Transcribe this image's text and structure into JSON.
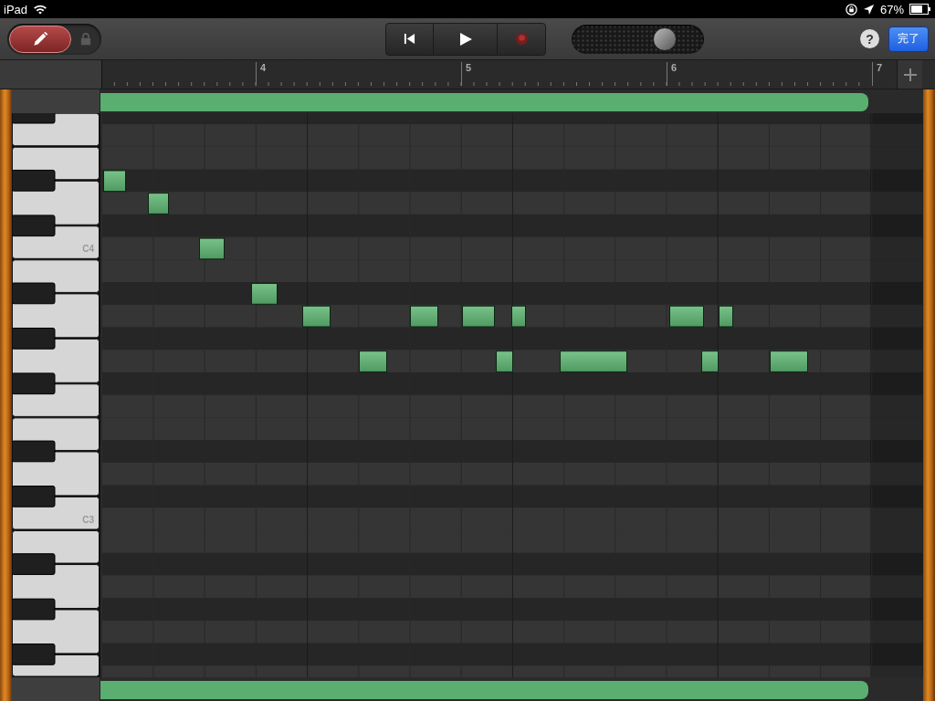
{
  "status_bar": {
    "device": "iPad",
    "battery": "67%"
  },
  "toolbar": {
    "pencil": {
      "selected": true
    },
    "volume": {
      "level": 0.78
    },
    "help_button": "?",
    "done_button": "完了"
  },
  "ruler": {
    "bars": [
      "4",
      "5",
      "6",
      "7"
    ]
  },
  "keyboard": {
    "labels": [
      "C4",
      "C3"
    ]
  }
}
